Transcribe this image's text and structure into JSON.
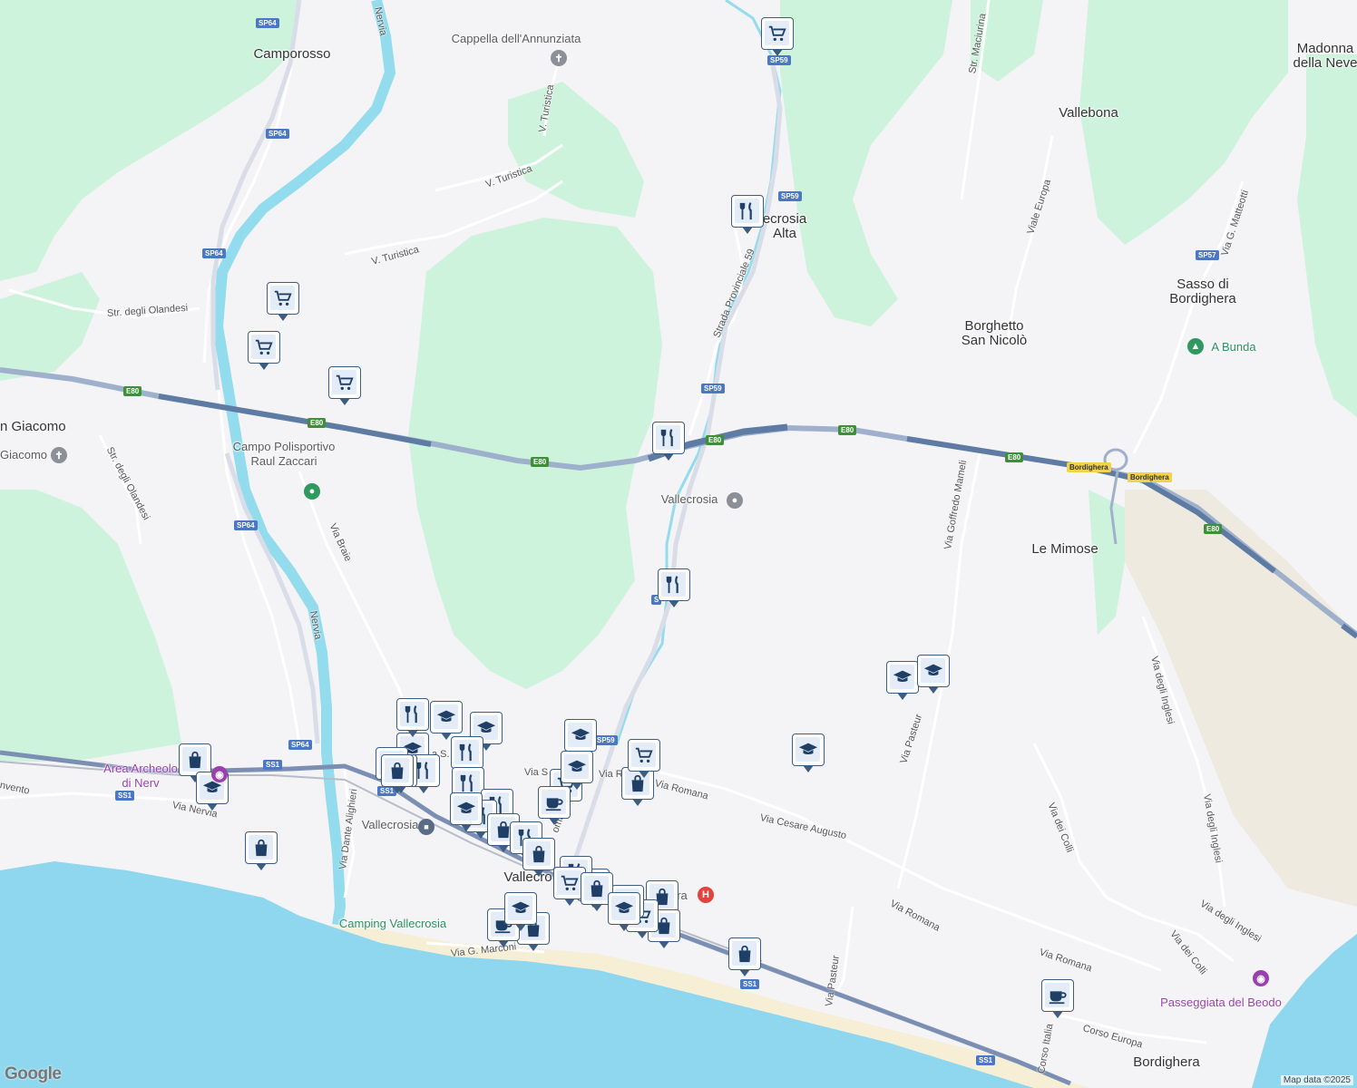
{
  "places": [
    {
      "name": "Camporosso",
      "big": true
    },
    {
      "name": "Cappella dell'Annunziata",
      "big": false
    },
    {
      "name": "Madonna\ndella Neve",
      "big": true
    },
    {
      "name": "Vallebona",
      "big": true
    },
    {
      "name": "ecrosia\nAlta",
      "big": true
    },
    {
      "name": "Sasso di\nBordighera",
      "big": true
    },
    {
      "name": "Borghetto\nSan Nicolò",
      "big": true
    },
    {
      "name": "n Giacomo",
      "big": true
    },
    {
      "name": "Giacomo",
      "big": false
    },
    {
      "name": "Campo Polisportivo\nRaul Zaccari",
      "big": false
    },
    {
      "name": "Vallecrosia",
      "big": false
    },
    {
      "name": "Le Mimose",
      "big": true
    },
    {
      "name": "Area Archeolo\ndi Nerv",
      "big": false
    },
    {
      "name": "Vallecrosia",
      "big": false
    },
    {
      "name": "Vallecro",
      "big": true
    },
    {
      "name": "Camping Vallecrosia",
      "big": false
    },
    {
      "name": "Passeggiata del Beodo",
      "big": false
    },
    {
      "name": "Bordighera",
      "big": true
    },
    {
      "name": "A Bunda",
      "big": false
    },
    {
      "name": "ra",
      "big": false
    }
  ],
  "streets": [
    "Nervia",
    "V. Turistica",
    "V. Turistica",
    "V. Turistica",
    "Str. degli Olandesi",
    "Str. degli Olandesi",
    "Strada Provinciale 59",
    "Str. Maciurina",
    "Viale Europa",
    "Via G. Matteotti",
    "Via Goffredo Mameli",
    "Via Braie",
    "Nervia",
    "Via Dante Alighieri",
    "Via Romana",
    "Via Cesare Augusto",
    "Via Romana",
    "Via Romana",
    "Via Pasteur",
    "Via Pasteur",
    "Via dei Colli",
    "Via dei Colli",
    "Via degli Inglesi",
    "Via degli Inglesi",
    "Via degli Inglesi",
    "Corso Europa",
    "Corso Italia",
    "Via G. Marconi",
    "Via Nervia",
    "nvento",
    "Vi",
    "a S.",
    "Via S",
    "Via R",
    "oma"
  ],
  "shields": [
    "SP64",
    "SP64",
    "SP64",
    "SP64",
    "SP64",
    "SP59",
    "SP59",
    "SP59",
    "SP59",
    "SP57",
    "E80",
    "E80",
    "E80",
    "E80",
    "E80",
    "E80",
    "E80",
    "Bordighera",
    "Bordighera",
    "SS1",
    "SS1",
    "SS1",
    "SS1",
    "SS1",
    "S"
  ],
  "pins": [
    "shopping-cart",
    "shopping-cart",
    "shopping-cart",
    "shopping-cart",
    "restaurant",
    "restaurant",
    "restaurant",
    "school",
    "school",
    "school",
    "school",
    "school",
    "school",
    "school",
    "shopping-bag",
    "shopping-bag",
    "shopping-bag",
    "shopping-bag",
    "shopping-bag",
    "shopping-bag",
    "shopping-bag",
    "shopping-bag",
    "restaurant",
    "restaurant",
    "restaurant",
    "restaurant",
    "restaurant",
    "restaurant",
    "shopping-cart",
    "shopping-cart",
    "shopping-cart",
    "coffee",
    "coffee",
    "coffee",
    "school",
    "school",
    "shopping-bag",
    "shopping-bag",
    "restaurant",
    "school",
    "shopping-bag",
    "restaurant",
    "shopping-cart",
    "shopping-bag",
    "school",
    "shopping-bag",
    "shopping-bag",
    "shopping-bag",
    "school"
  ],
  "colors": {
    "sea": "#8fd7ee",
    "park": "#cdf3dc",
    "land": "#f4f3f6",
    "motorway": "#5d7ba3",
    "river": "#93dcee"
  },
  "attribution": "Map data ©2025",
  "logo": "Google"
}
